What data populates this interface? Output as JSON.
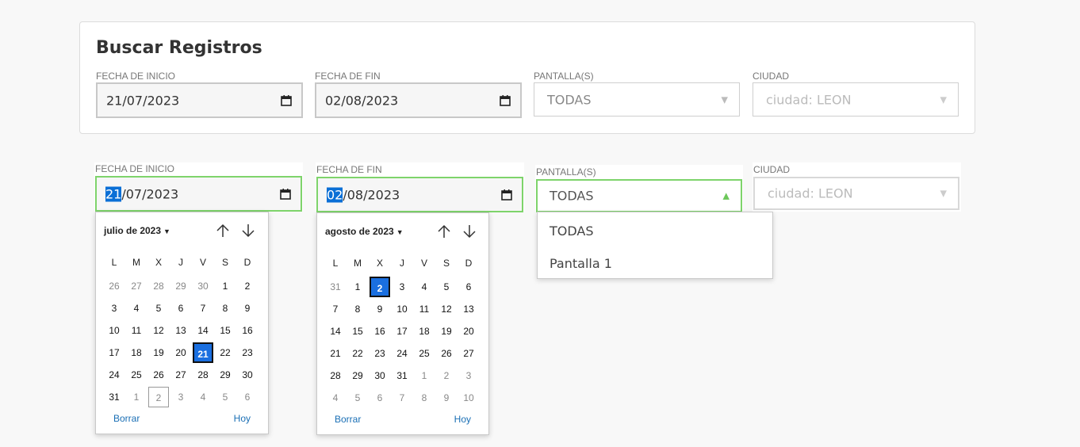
{
  "card": {
    "title": "Buscar Registros",
    "fecha_inicio": {
      "label": "FECHA DE INICIO",
      "value": "21/07/2023"
    },
    "fecha_fin": {
      "label": "FECHA DE FIN",
      "value": "02/08/2023"
    },
    "pantalla": {
      "label": "PANTALLA(S)",
      "value": "TODAS"
    },
    "ciudad": {
      "label": "CIUDAD",
      "value": "ciudad: LEON"
    }
  },
  "form2": {
    "fecha_inicio": {
      "label": "FECHA DE INICIO",
      "value_sel": "21",
      "value_rest": "/07/2023"
    },
    "fecha_fin": {
      "label": "FECHA DE FIN",
      "value_sel": "02",
      "value_rest": "/08/2023"
    },
    "pantalla": {
      "label": "PANTALLA(S)",
      "value": "TODAS"
    },
    "ciudad": {
      "label": "CIUDAD",
      "value": "ciudad: LEON"
    }
  },
  "weekdays": [
    "L",
    "M",
    "X",
    "J",
    "V",
    "S",
    "D"
  ],
  "calendar_july": {
    "month_label": "julio de 2023",
    "weeks": [
      [
        "26",
        "27",
        "28",
        "29",
        "30",
        "1",
        "2"
      ],
      [
        "3",
        "4",
        "5",
        "6",
        "7",
        "8",
        "9"
      ],
      [
        "10",
        "11",
        "12",
        "13",
        "14",
        "15",
        "16"
      ],
      [
        "17",
        "18",
        "19",
        "20",
        "21",
        "22",
        "23"
      ],
      [
        "24",
        "25",
        "26",
        "27",
        "28",
        "29",
        "30"
      ],
      [
        "31",
        "1",
        "2",
        "3",
        "4",
        "5",
        "6"
      ]
    ],
    "clear_label": "Borrar",
    "today_label": "Hoy"
  },
  "calendar_august": {
    "month_label": "agosto de 2023",
    "weeks": [
      [
        "31",
        "1",
        "2",
        "3",
        "4",
        "5",
        "6"
      ],
      [
        "7",
        "8",
        "9",
        "10",
        "11",
        "12",
        "13"
      ],
      [
        "14",
        "15",
        "16",
        "17",
        "18",
        "19",
        "20"
      ],
      [
        "21",
        "22",
        "23",
        "24",
        "25",
        "26",
        "27"
      ],
      [
        "28",
        "29",
        "30",
        "31",
        "1",
        "2",
        "3"
      ],
      [
        "4",
        "5",
        "6",
        "7",
        "8",
        "9",
        "10"
      ]
    ],
    "clear_label": "Borrar",
    "today_label": "Hoy"
  },
  "pantalla_options": [
    "TODAS",
    "Pantalla 1"
  ],
  "colors": {
    "focus_border": "#7ed46b",
    "selected_day": "#1a6fe0",
    "link": "#1a6fb5"
  }
}
